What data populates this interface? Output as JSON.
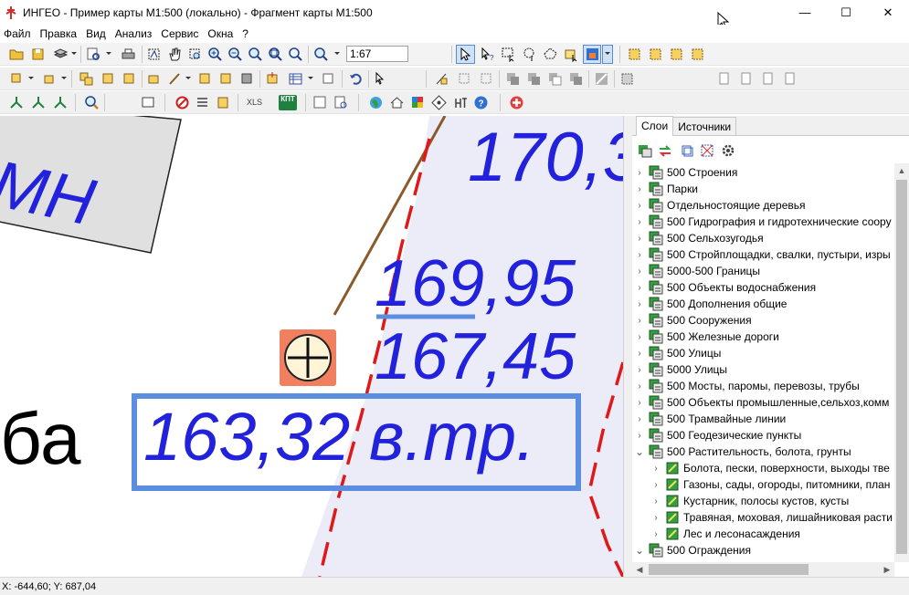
{
  "window": {
    "title": "ИНГЕО - Пример карты М1:500 (локально) - Фрагмент карты М1:500",
    "min_glyph": "—",
    "max_glyph": "☐",
    "close_glyph": "✕"
  },
  "menu": [
    "Файл",
    "Правка",
    "Вид",
    "Анализ",
    "Сервис",
    "Окна",
    "?"
  ],
  "toolbar": {
    "scale_value": "1:67",
    "xls_label": "XLS",
    "kpt_label": "КПТ",
    "help_glyph": "?",
    "icons": [
      "open-icon",
      "save-icon",
      "layers-icon",
      "preview-icon",
      "print-icon",
      "select-all-icon",
      "pan-icon",
      "zoom-window-icon",
      "zoom-in-icon",
      "zoom-out-icon",
      "zoom-prev-icon",
      "zoom-next-icon",
      "zoom-scale-icon",
      "pointer-icon",
      "pointer-query-icon",
      "select-rect-icon",
      "select-lasso-icon",
      "select-polygon-icon",
      "select-object-icon",
      "fill-color-icon"
    ]
  },
  "map": {
    "labels": {
      "top": "170,3",
      "upper_value": "169,95",
      "middle_value": "167,45",
      "boxed_value": "163,32 в.тр.",
      "left_top": "МН",
      "left_bottom": "ба"
    },
    "colors": {
      "label_blue": "#2222dd",
      "box_border": "#5b8ee0",
      "dash_red": "#e01818",
      "brown_line": "#8b5a2b",
      "zone_fill": "#ececf8",
      "marker_fill": "#f08060"
    }
  },
  "panel": {
    "tabs": [
      "Слои",
      "Источники"
    ],
    "active_tab": "Слои",
    "layers": [
      {
        "label": "500 Строения",
        "expanded": false,
        "child": false
      },
      {
        "label": "Парки",
        "expanded": false,
        "child": false
      },
      {
        "label": "Отдельностоящие деревья",
        "expanded": false,
        "child": false
      },
      {
        "label": "500 Гидрография и гидротехнические соору",
        "expanded": false,
        "child": false
      },
      {
        "label": "500 Сельхозугодья",
        "expanded": false,
        "child": false
      },
      {
        "label": "500 Стройплощадки, свалки, пустыри, изры",
        "expanded": false,
        "child": false
      },
      {
        "label": "5000-500 Границы",
        "expanded": false,
        "child": false
      },
      {
        "label": "500 Объекты водоснабжения",
        "expanded": false,
        "child": false
      },
      {
        "label": "500 Дополнения общие",
        "expanded": false,
        "child": false
      },
      {
        "label": "500 Сооружения",
        "expanded": false,
        "child": false
      },
      {
        "label": "500 Железные дороги",
        "expanded": false,
        "child": false
      },
      {
        "label": "500 Улицы",
        "expanded": false,
        "child": false
      },
      {
        "label": "5000 Улицы",
        "expanded": false,
        "child": false
      },
      {
        "label": "500 Мосты, паромы, перевозы, трубы",
        "expanded": false,
        "child": false
      },
      {
        "label": "500 Объекты промышленные,сельхоз,комм",
        "expanded": false,
        "child": false
      },
      {
        "label": "500 Трамвайные линии",
        "expanded": false,
        "child": false
      },
      {
        "label": "500 Геодезические пункты",
        "expanded": false,
        "child": false
      },
      {
        "label": "500 Растительность, болота, грунты",
        "expanded": true,
        "child": false
      },
      {
        "label": "Болота, пески, поверхности, выходы тве",
        "expanded": false,
        "child": true
      },
      {
        "label": "Газоны, сады, огороды, питомники, план",
        "expanded": false,
        "child": true
      },
      {
        "label": "Кустарник, полосы кустов, кусты",
        "expanded": false,
        "child": true
      },
      {
        "label": "Травяная, моховая, лишайниковая расти",
        "expanded": false,
        "child": true
      },
      {
        "label": "Лес и лесонасаждения",
        "expanded": false,
        "child": true
      },
      {
        "label": "500 Ограждения",
        "expanded": true,
        "child": false
      }
    ],
    "chevron_collapsed": "›",
    "chevron_expanded": "⌄",
    "scroll_up_glyph": "▲",
    "scroll_left_glyph": "◀",
    "scroll_right_glyph": "▶"
  },
  "status": {
    "coords": "X: -644,60; Y: 687,04"
  }
}
